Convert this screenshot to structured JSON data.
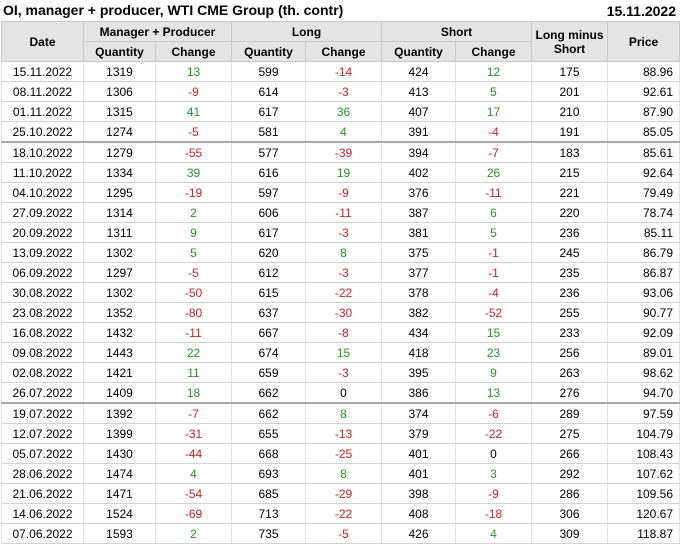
{
  "header": {
    "title": "OI, manager + producer, WTI CME Group (th. contr)",
    "date": "15.11.2022"
  },
  "columns": {
    "date": "Date",
    "group_mp": "Manager + Producer",
    "group_long": "Long",
    "group_short": "Short",
    "long_minus_short": "Long minus Short",
    "price": "Price",
    "quantity": "Quantity",
    "change": "Change"
  },
  "colors": {
    "positive": "#1f9b1f",
    "negative": "#d11f1f",
    "header_bg": "#e4e4e4"
  },
  "rows": [
    {
      "date": "15.11.2022",
      "mp_qty": "1319",
      "mp_chg": "13",
      "long_qty": "599",
      "long_chg": "-14",
      "short_qty": "424",
      "short_chg": "12",
      "lms": "175",
      "price": "88.96"
    },
    {
      "date": "08.11.2022",
      "mp_qty": "1306",
      "mp_chg": "-9",
      "long_qty": "614",
      "long_chg": "-3",
      "short_qty": "413",
      "short_chg": "5",
      "lms": "201",
      "price": "92.61"
    },
    {
      "date": "01.11.2022",
      "mp_qty": "1315",
      "mp_chg": "41",
      "long_qty": "617",
      "long_chg": "36",
      "short_qty": "407",
      "short_chg": "17",
      "lms": "210",
      "price": "87.90"
    },
    {
      "date": "25.10.2022",
      "mp_qty": "1274",
      "mp_chg": "-5",
      "long_qty": "581",
      "long_chg": "4",
      "short_qty": "391",
      "short_chg": "-4",
      "lms": "191",
      "price": "85.05"
    },
    {
      "date": "18.10.2022",
      "mp_qty": "1279",
      "mp_chg": "-55",
      "long_qty": "577",
      "long_chg": "-39",
      "short_qty": "394",
      "short_chg": "-7",
      "lms": "183",
      "price": "85.61"
    },
    {
      "date": "11.10.2022",
      "mp_qty": "1334",
      "mp_chg": "39",
      "long_qty": "616",
      "long_chg": "19",
      "short_qty": "402",
      "short_chg": "26",
      "lms": "215",
      "price": "92.64"
    },
    {
      "date": "04.10.2022",
      "mp_qty": "1295",
      "mp_chg": "-19",
      "long_qty": "597",
      "long_chg": "-9",
      "short_qty": "376",
      "short_chg": "-11",
      "lms": "221",
      "price": "79.49"
    },
    {
      "date": "27.09.2022",
      "mp_qty": "1314",
      "mp_chg": "2",
      "long_qty": "606",
      "long_chg": "-11",
      "short_qty": "387",
      "short_chg": "6",
      "lms": "220",
      "price": "78.74"
    },
    {
      "date": "20.09.2022",
      "mp_qty": "1311",
      "mp_chg": "9",
      "long_qty": "617",
      "long_chg": "-3",
      "short_qty": "381",
      "short_chg": "5",
      "lms": "236",
      "price": "85.11"
    },
    {
      "date": "13.09.2022",
      "mp_qty": "1302",
      "mp_chg": "5",
      "long_qty": "620",
      "long_chg": "8",
      "short_qty": "375",
      "short_chg": "-1",
      "lms": "245",
      "price": "86.79"
    },
    {
      "date": "06.09.2022",
      "mp_qty": "1297",
      "mp_chg": "-5",
      "long_qty": "612",
      "long_chg": "-3",
      "short_qty": "377",
      "short_chg": "-1",
      "lms": "235",
      "price": "86.87"
    },
    {
      "date": "30.08.2022",
      "mp_qty": "1302",
      "mp_chg": "-50",
      "long_qty": "615",
      "long_chg": "-22",
      "short_qty": "378",
      "short_chg": "-4",
      "lms": "236",
      "price": "93.06"
    },
    {
      "date": "23.08.2022",
      "mp_qty": "1352",
      "mp_chg": "-80",
      "long_qty": "637",
      "long_chg": "-30",
      "short_qty": "382",
      "short_chg": "-52",
      "lms": "255",
      "price": "90.77"
    },
    {
      "date": "16.08.2022",
      "mp_qty": "1432",
      "mp_chg": "-11",
      "long_qty": "667",
      "long_chg": "-8",
      "short_qty": "434",
      "short_chg": "15",
      "lms": "233",
      "price": "92.09"
    },
    {
      "date": "09.08.2022",
      "mp_qty": "1443",
      "mp_chg": "22",
      "long_qty": "674",
      "long_chg": "15",
      "short_qty": "418",
      "short_chg": "23",
      "lms": "256",
      "price": "89.01"
    },
    {
      "date": "02.08.2022",
      "mp_qty": "1421",
      "mp_chg": "11",
      "long_qty": "659",
      "long_chg": "-3",
      "short_qty": "395",
      "short_chg": "9",
      "lms": "263",
      "price": "98.62"
    },
    {
      "date": "26.07.2022",
      "mp_qty": "1409",
      "mp_chg": "18",
      "long_qty": "662",
      "long_chg": "0",
      "short_qty": "386",
      "short_chg": "13",
      "lms": "276",
      "price": "94.70"
    },
    {
      "date": "19.07.2022",
      "mp_qty": "1392",
      "mp_chg": "-7",
      "long_qty": "662",
      "long_chg": "8",
      "short_qty": "374",
      "short_chg": "-6",
      "lms": "289",
      "price": "97.59"
    },
    {
      "date": "12.07.2022",
      "mp_qty": "1399",
      "mp_chg": "-31",
      "long_qty": "655",
      "long_chg": "-13",
      "short_qty": "379",
      "short_chg": "-22",
      "lms": "275",
      "price": "104.79"
    },
    {
      "date": "05.07.2022",
      "mp_qty": "1430",
      "mp_chg": "-44",
      "long_qty": "668",
      "long_chg": "-25",
      "short_qty": "401",
      "short_chg": "0",
      "lms": "266",
      "price": "108.43"
    },
    {
      "date": "28.06.2022",
      "mp_qty": "1474",
      "mp_chg": "4",
      "long_qty": "693",
      "long_chg": "8",
      "short_qty": "401",
      "short_chg": "3",
      "lms": "292",
      "price": "107.62"
    },
    {
      "date": "21.06.2022",
      "mp_qty": "1471",
      "mp_chg": "-54",
      "long_qty": "685",
      "long_chg": "-29",
      "short_qty": "398",
      "short_chg": "-9",
      "lms": "286",
      "price": "109.56"
    },
    {
      "date": "14.06.2022",
      "mp_qty": "1524",
      "mp_chg": "-69",
      "long_qty": "713",
      "long_chg": "-22",
      "short_qty": "408",
      "short_chg": "-18",
      "lms": "306",
      "price": "120.67"
    },
    {
      "date": "07.06.2022",
      "mp_qty": "1593",
      "mp_chg": "2",
      "long_qty": "735",
      "long_chg": "-5",
      "short_qty": "426",
      "short_chg": "4",
      "lms": "309",
      "price": "118.87"
    }
  ]
}
